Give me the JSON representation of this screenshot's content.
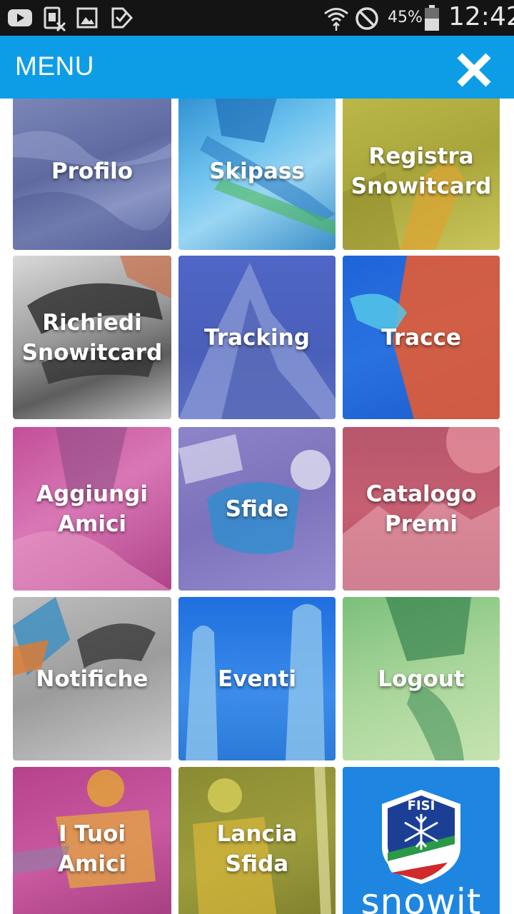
{
  "status_bar": {
    "battery": "45%",
    "time": "12:42"
  },
  "app_bar": {
    "title": "MENU"
  },
  "colors": {
    "accent": "#0d9de6",
    "status_bar": "#141414"
  },
  "menu": {
    "profilo": "Profilo",
    "skipass": "Skipass",
    "registra": "Registra\nSnowitcard",
    "richiedi": "Richiedi\nSnowitcard",
    "tracking": "Tracking",
    "tracce": "Tracce",
    "aggiungi": "Aggiungi\nAmici",
    "sfide": "Sfide",
    "catalogo": "Catalogo\nPremi",
    "notifiche": "Notifiche",
    "eventi": "Eventi",
    "logout": "Logout",
    "tuoi_amici": "I Tuoi\nAmici",
    "lancia": "Lancia\nSfida"
  },
  "logo": {
    "badge": "FISI",
    "brand": "snowit"
  }
}
